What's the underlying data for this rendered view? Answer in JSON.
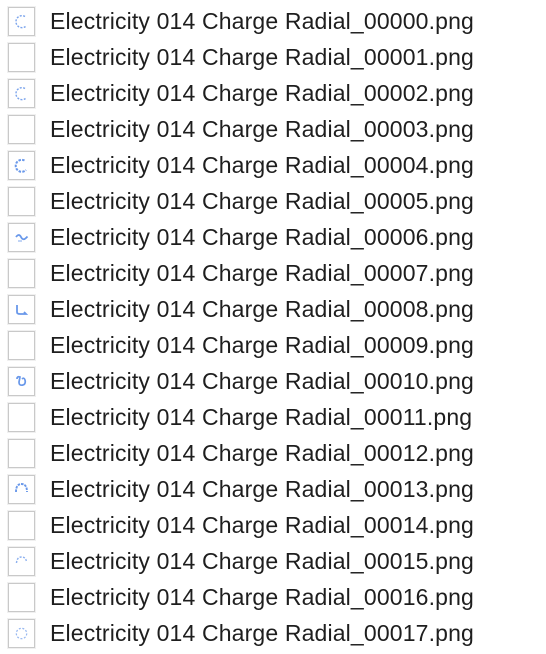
{
  "files": [
    {
      "name": "Electricity 014 Charge Radial_00000.png",
      "preview": "arc-c"
    },
    {
      "name": "Electricity 014 Charge Radial_00001.png",
      "preview": "blank"
    },
    {
      "name": "Electricity 014 Charge Radial_00002.png",
      "preview": "arc-c"
    },
    {
      "name": "Electricity 014 Charge Radial_00003.png",
      "preview": "blank"
    },
    {
      "name": "Electricity 014 Charge Radial_00004.png",
      "preview": "arc-c-bold"
    },
    {
      "name": "Electricity 014 Charge Radial_00005.png",
      "preview": "blank"
    },
    {
      "name": "Electricity 014 Charge Radial_00006.png",
      "preview": "squiggle"
    },
    {
      "name": "Electricity 014 Charge Radial_00007.png",
      "preview": "blank"
    },
    {
      "name": "Electricity 014 Charge Radial_00008.png",
      "preview": "hook"
    },
    {
      "name": "Electricity 014 Charge Radial_00009.png",
      "preview": "blank"
    },
    {
      "name": "Electricity 014 Charge Radial_00010.png",
      "preview": "curl"
    },
    {
      "name": "Electricity 014 Charge Radial_00011.png",
      "preview": "blank"
    },
    {
      "name": "Electricity 014 Charge Radial_00012.png",
      "preview": "blank"
    },
    {
      "name": "Electricity 014 Charge Radial_00013.png",
      "preview": "arc-top"
    },
    {
      "name": "Electricity 014 Charge Radial_00014.png",
      "preview": "blank"
    },
    {
      "name": "Electricity 014 Charge Radial_00015.png",
      "preview": "arc-top-light"
    },
    {
      "name": "Electricity 014 Charge Radial_00016.png",
      "preview": "blank"
    },
    {
      "name": "Electricity 014 Charge Radial_00017.png",
      "preview": "ring-light"
    }
  ],
  "colors": {
    "text": "#1e1e1e",
    "thumbnail_border": "#c9c9c9",
    "preview_stroke": "#4f86e6"
  }
}
